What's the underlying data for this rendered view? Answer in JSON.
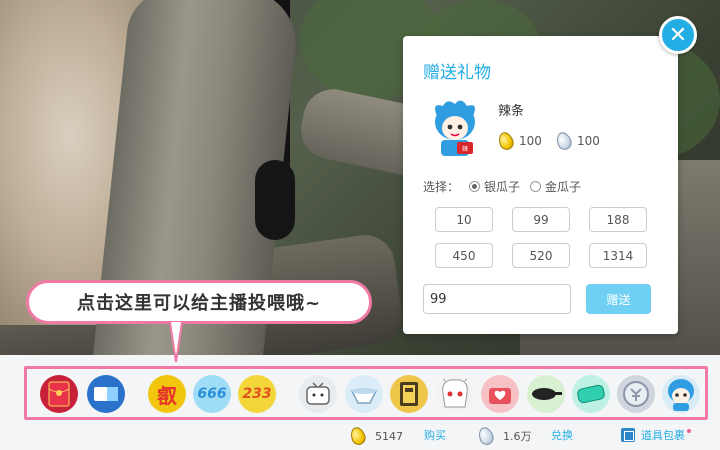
{
  "tip": {
    "text": "点击这里可以给主播投喂哦~"
  },
  "dialog": {
    "title": "赠送礼物",
    "gift_name": "辣条",
    "gold_price": "100",
    "silver_price": "100",
    "choose_label": "选择：",
    "option_silver": "银瓜子",
    "option_gold": "金瓜子",
    "selected_option": "银瓜子",
    "quantities": [
      "10",
      "99",
      "188",
      "450",
      "520",
      "1314"
    ],
    "quantity_value": "99",
    "send_label": "赠送",
    "close_icon": "close-icon"
  },
  "giftbar": {
    "items": [
      {
        "name": "red-packet-gift",
        "color": "#c8213a"
      },
      {
        "name": "ticket-gift",
        "color": "#2a71c9"
      },
      {
        "name": "fei-gift",
        "text": "㕡",
        "color": "#f2c60f"
      },
      {
        "name": "666-gift",
        "text": "666",
        "color": "#9fdcf5"
      },
      {
        "name": "233-gift",
        "text": "233",
        "color": "#f2d63a"
      },
      {
        "name": "tv-gift",
        "color": "#e9ecef"
      },
      {
        "name": "bowl-gift",
        "color": "#d9ecf7"
      },
      {
        "name": "book-gift",
        "color": "#eec74a"
      },
      {
        "name": "character-gift",
        "color": "#f3f3f3"
      },
      {
        "name": "heart-box-gift",
        "color": "#f6c2c6"
      },
      {
        "name": "pan-gift",
        "color": "#d7f0cf"
      },
      {
        "name": "pillow-gift",
        "color": "#bff0e4"
      },
      {
        "name": "coin-gift",
        "color": "#cfd6dd"
      },
      {
        "name": "22-niang-gift",
        "color": "#d8ecf8"
      }
    ]
  },
  "status": {
    "gold_count": "5147",
    "buy_label": "购买",
    "silver_count": "1.6万",
    "exchange_label": "兑换",
    "package_label": "道具包裹"
  },
  "colors": {
    "accent": "#23ade5",
    "pink": "#f07aa5"
  }
}
